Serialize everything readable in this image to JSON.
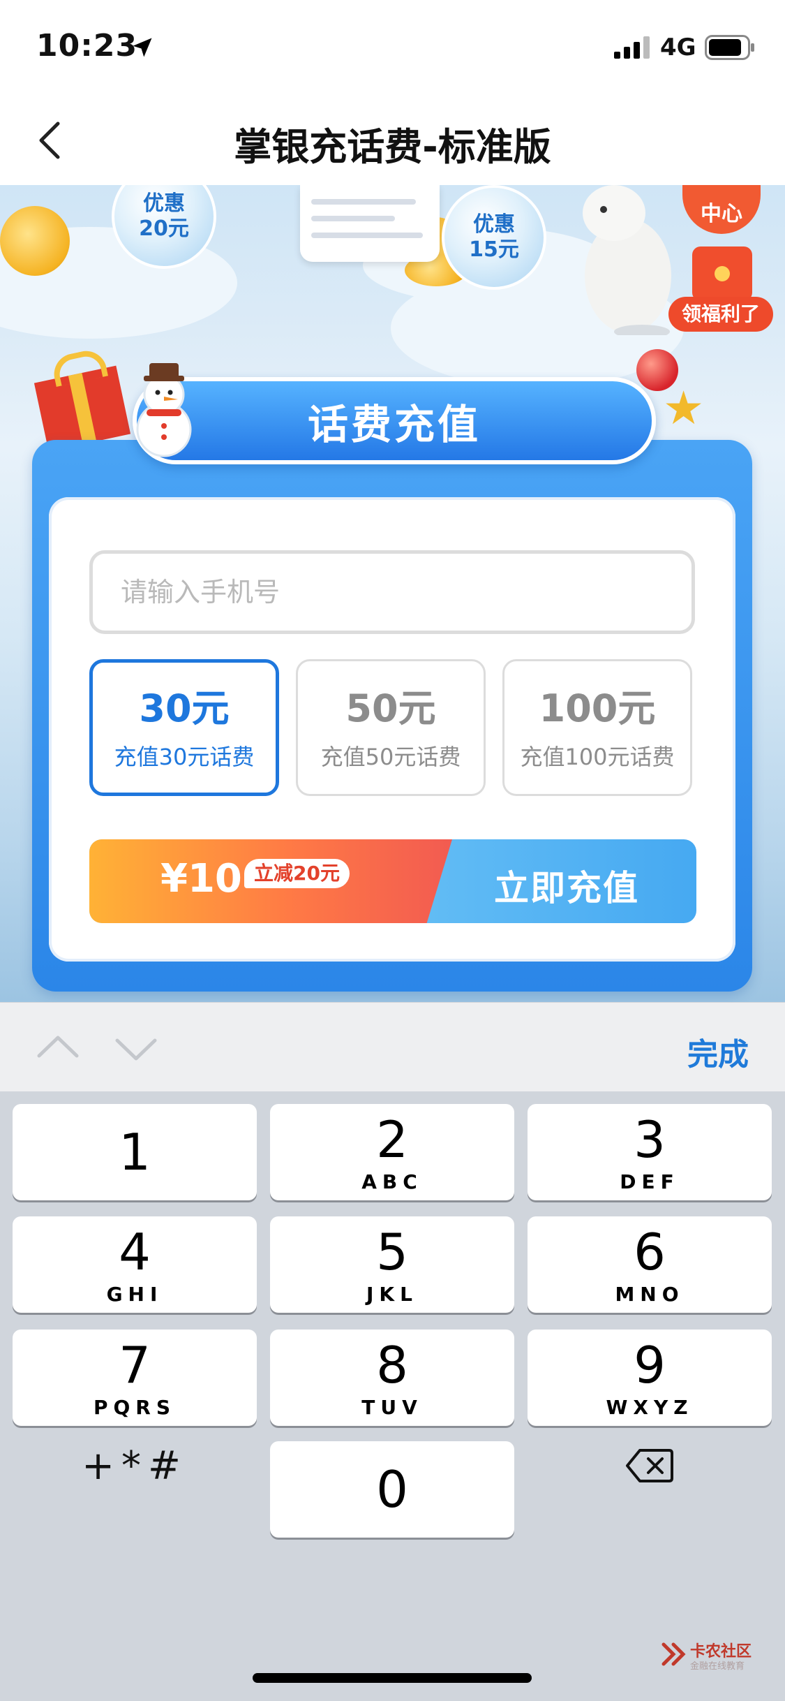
{
  "status_bar": {
    "time": "10:23",
    "network": "4G"
  },
  "nav": {
    "title": "掌银充话费-标准版"
  },
  "banner": {
    "bubble_left": [
      "优惠",
      "20元"
    ],
    "bubble_right": [
      "优惠",
      "15元"
    ],
    "center_badge": "中心",
    "welfare_badge": "领福利了"
  },
  "card": {
    "title": "话费充值",
    "phone_input": {
      "value": "",
      "placeholder": "请输入手机号"
    },
    "options": [
      {
        "amount": "30元",
        "desc": "充值30元话费",
        "selected": true
      },
      {
        "amount": "50元",
        "desc": "充值50元话费",
        "selected": false
      },
      {
        "amount": "100元",
        "desc": "充值100元话费",
        "selected": false
      }
    ],
    "pay": {
      "price": "¥10",
      "discount": "立减20元",
      "button": "立即充值"
    }
  },
  "keyboard_toolbar": {
    "done": "完成"
  },
  "keyboard": {
    "keys": [
      {
        "digit": "1",
        "letters": ""
      },
      {
        "digit": "2",
        "letters": "ABC"
      },
      {
        "digit": "3",
        "letters": "DEF"
      },
      {
        "digit": "4",
        "letters": "GHI"
      },
      {
        "digit": "5",
        "letters": "JKL"
      },
      {
        "digit": "6",
        "letters": "MNO"
      },
      {
        "digit": "7",
        "letters": "PQRS"
      },
      {
        "digit": "8",
        "letters": "TUV"
      },
      {
        "digit": "9",
        "letters": "WXYZ"
      },
      {
        "digit": "0",
        "letters": ""
      }
    ],
    "symbols": "+*#"
  },
  "watermark": {
    "text": "卡农社区",
    "sub": "金融在线教育"
  },
  "colors": {
    "accent": "#1e77dd",
    "card_blue": "#2b86e8",
    "pay_orange": "#ff7a45",
    "done_blue": "#1f7ad9"
  }
}
